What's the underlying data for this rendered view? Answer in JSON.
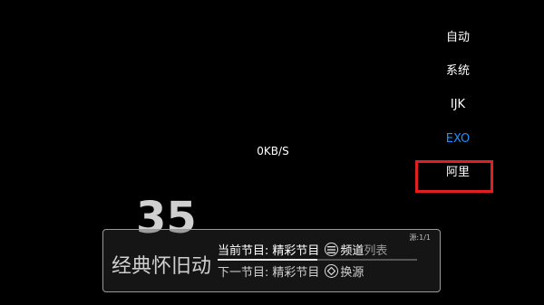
{
  "status": {
    "speed": "0KB/S"
  },
  "decoder_menu": {
    "items": [
      {
        "label": "自动",
        "active": false
      },
      {
        "label": "系统",
        "active": false
      },
      {
        "label": "IJK",
        "active": false
      },
      {
        "label": "EXO",
        "active": true
      },
      {
        "label": "阿里",
        "active": false
      }
    ],
    "active_color": "#1e90ff",
    "highlighted_item": "阿里",
    "highlight_color": "#e02020"
  },
  "channel": {
    "number": "35",
    "name": "经典怀旧动",
    "source": "源:1/1"
  },
  "program": {
    "current_label": "当前节目:",
    "current_title": "精彩节目",
    "next_label": "下一节目:",
    "next_title": "精彩节目",
    "progress": 0.5
  },
  "hints": {
    "channel_list_a": "频道",
    "channel_list_b": "列表",
    "change_source": "换源",
    "list_icon": "menu-lines-icon",
    "source_icon": "diamond-arrows-icon"
  }
}
